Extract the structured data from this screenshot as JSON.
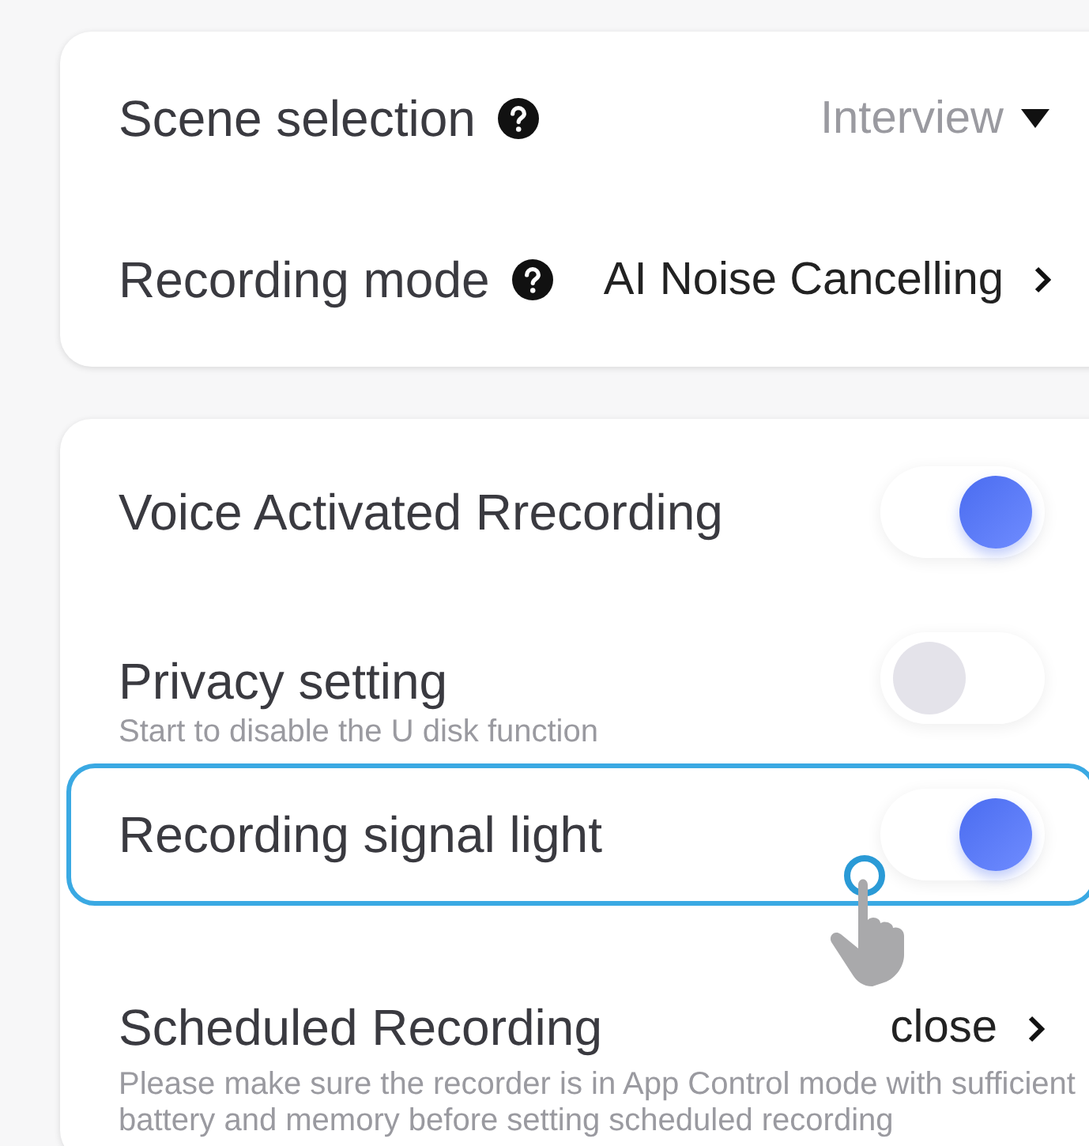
{
  "cards": [
    {
      "rows": [
        {
          "kind": "dropdown",
          "label": "Scene selection",
          "help": true,
          "value": "Interview"
        },
        {
          "kind": "link",
          "label": "Recording mode",
          "help": true,
          "value": "AI Noise Cancelling"
        }
      ]
    },
    {
      "rows": [
        {
          "kind": "toggle",
          "label": "Voice Activated Rrecording",
          "on": true,
          "highlighted": false
        },
        {
          "kind": "toggle",
          "label": "Privacy setting",
          "subtitle": "Start to disable the U disk function",
          "on": false,
          "highlighted": false
        },
        {
          "kind": "toggle",
          "label": "Recording signal light",
          "on": true,
          "highlighted": true,
          "pointer": true
        },
        {
          "kind": "link",
          "label": "Scheduled Recording",
          "value": "close",
          "subtitle": "Please make sure the recorder is in App Control mode with sufficient battery and memory before setting scheduled recording",
          "highlighted": false
        }
      ]
    }
  ]
}
